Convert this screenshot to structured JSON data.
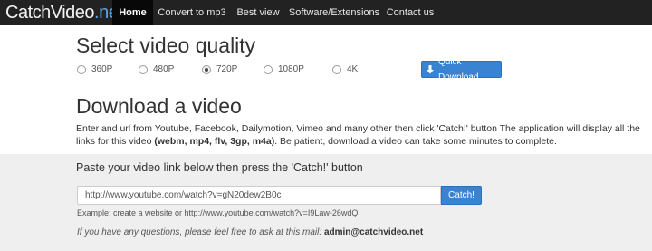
{
  "navbar": {
    "brand_part1": "CatchVideo",
    "brand_part2": ".net",
    "items": [
      {
        "label": "Home"
      },
      {
        "label": "Convert to mp3"
      },
      {
        "label": "Best view"
      },
      {
        "label": "Software/Extensions"
      },
      {
        "label": "Contact us"
      }
    ]
  },
  "quality": {
    "title": "Select video quality",
    "options": [
      {
        "label": "360P",
        "checked": false
      },
      {
        "label": "480P",
        "checked": false
      },
      {
        "label": "720P",
        "checked": true
      },
      {
        "label": "1080P",
        "checked": false
      },
      {
        "label": "4K",
        "checked": false
      }
    ],
    "quick_download_label": "Quick Download"
  },
  "download": {
    "title": "Download a video",
    "desc_part1": "Enter and url from Youtube, Facebook, Dailymotion, Vimeo and many other then click 'Catch!' button The application will display all the links for this video ",
    "desc_formats": "(webm, mp4, flv, 3gp, m4a)",
    "desc_part2": ". Be patient, download a video can take some minutes to complete."
  },
  "paste": {
    "title": "Paste your video link below then press the 'Catch!' button",
    "input_value": "http://www.youtube.com/watch?v=gN20dew2B0c",
    "catch_label": "Catch!",
    "example": "Example: create a website or http://www.youtube.com/watch?v=I9Law-26wdQ",
    "questions_text": "If you have any questions, please feel free to ask at this mail: ",
    "email": "admin@catchvideo.net"
  },
  "colors": {
    "navbar_bg": "#222222",
    "brand_accent": "#5aa6e8",
    "button_primary": "#3a83d3",
    "grey_section": "#efefef"
  }
}
